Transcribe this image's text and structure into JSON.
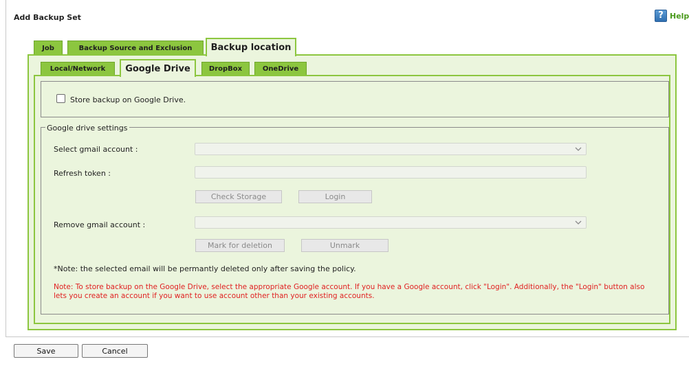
{
  "dialog": {
    "title": "Add Backup Set",
    "help_label": "Help"
  },
  "tabs": [
    {
      "label": "Job",
      "active": false
    },
    {
      "label": "Backup Source and Exclusion",
      "active": false
    },
    {
      "label": "Backup location",
      "active": true
    }
  ],
  "subtabs": [
    {
      "label": "Local/Network",
      "active": false
    },
    {
      "label": "Google Drive",
      "active": true
    },
    {
      "label": "DropBox",
      "active": false
    },
    {
      "label": "OneDrive",
      "active": false
    }
  ],
  "store": {
    "label": "Store backup on Google Drive.",
    "checked": false
  },
  "settings": {
    "legend": "Google drive settings",
    "select_account_label": "Select gmail account :",
    "select_account_value": "",
    "refresh_token_label": "Refresh token :",
    "refresh_token_value": "",
    "check_storage_label": "Check Storage",
    "login_label": "Login",
    "remove_account_label": "Remove gmail account :",
    "remove_account_value": "",
    "mark_deletion_label": "Mark for deletion",
    "unmark_label": "Unmark",
    "note": "*Note: the selected email will be permantly deleted only after saving the policy.",
    "warning": "Note: To store backup on the Google Drive, select the appropriate Google account. If you have a Google account, click \"Login\". Additionally, the \"Login\" button also lets you create an account if you want to use account other than your existing accounts."
  },
  "footer": {
    "save_label": "Save",
    "cancel_label": "Cancel"
  },
  "colors": {
    "accent": "#8cc63f",
    "panel": "#ebf5dd",
    "warning": "#e02020"
  },
  "icons": {
    "help": "help-icon",
    "dropdown": "chevron-down-icon"
  }
}
